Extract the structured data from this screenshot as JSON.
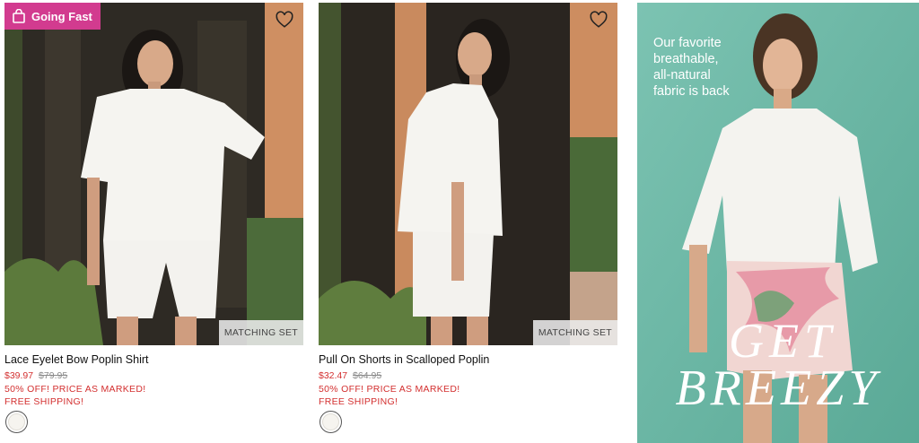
{
  "products": [
    {
      "badge": "Going Fast",
      "name": "Lace Eyelet Bow Poplin Shirt",
      "sale_price": "$39.97",
      "original_price": "$79.95",
      "promo_line_1": "50% OFF! PRICE AS MARKED!",
      "promo_line_2": "FREE SHIPPING!",
      "tag": "MATCHING SET",
      "icons": [
        "shopping-bag-icon",
        "heart-icon"
      ]
    },
    {
      "name": "Pull On Shorts in Scalloped Poplin",
      "sale_price": "$32.47",
      "original_price": "$64.95",
      "promo_line_1": "50% OFF! PRICE AS MARKED!",
      "promo_line_2": "FREE SHIPPING!",
      "tag": "MATCHING SET",
      "icons": [
        "heart-icon"
      ]
    }
  ],
  "promo_tile": {
    "copy": [
      "Our favorite",
      "breathable,",
      "all-natural",
      "fabric is back"
    ],
    "headline_1": "GET",
    "headline_2": "BREEZY"
  },
  "colors": {
    "badge": "#d23b8f",
    "sale": "#d32f2f",
    "promo_background": "#6fb9a8"
  }
}
